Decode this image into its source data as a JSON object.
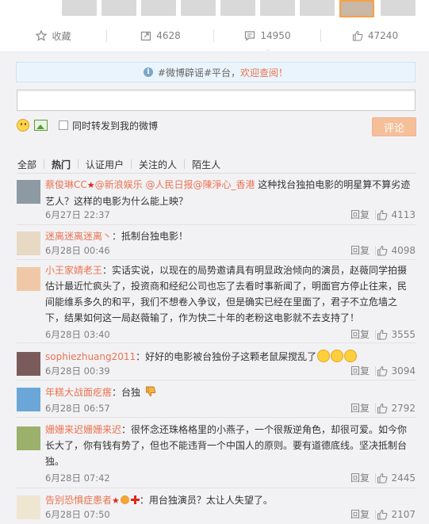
{
  "actions": {
    "favorite": "收藏",
    "repost": "4628",
    "comment": "14950",
    "like": "47240"
  },
  "notice": {
    "prefix": "#微博辟谣#平台，",
    "link": "欢迎查阅！"
  },
  "composer": {
    "input_value": "",
    "also_repost": "同时转发到我的微博",
    "submit": "评论"
  },
  "filters": [
    "全部",
    "热门",
    "认证用户",
    "关注的人",
    "陌生人"
  ],
  "comments": [
    {
      "user": "蔡俊琳CC",
      "badge": "★",
      "mentions": "@新浪娱乐 @人民日报@陳淨心_香港",
      "text": " 这种找台独拍电影的明星算不算劣迹艺人？这样的电影为什么能上映？",
      "time": "6月27日 22:37",
      "reply": "回复",
      "likes": "4113"
    },
    {
      "user": "迷离迷离迷离丶",
      "text": "：抵制台独电影！",
      "time": "6月28日 00:46",
      "reply": "回复",
      "likes": "4098"
    },
    {
      "user": "小王家婧老王",
      "text": "：实话实说，以现在的局势邀请具有明显政治倾向的演员，赵薇同学拍摄估计最近忙疯头了，投资商和经纪公司也忘了去看时事新闻了，明面官方停止往来，民间能维系多久的和平，我们不想卷入争议，但是确实已经在里面了，君子不立危墙之下，结果如何这一局赵薇输了，作为快二十年的老粉这电影就不去支持了！",
      "time": "6月28日 03:40",
      "reply": "回复",
      "likes": "3555"
    },
    {
      "user": "sophiezhuang2011",
      "text": "：好好的电影被台独份子这颗老鼠屎搅乱了",
      "time": "6月28日 00:39",
      "reply": "回复",
      "likes": "3094"
    },
    {
      "user": "年糕大战面疙瘩",
      "text": "：台独",
      "time": "6月28日 06:57",
      "reply": "回复",
      "likes": "2792"
    },
    {
      "user": "姗姗来迟姗姗来迟",
      "text": "：很怀念还珠格格里的小燕子，一个很叛逆角色，却很可爱。如今你长大了，你有钱有势了，但也不能违背一个中国人的原则。要有道德底线。坚决抵制台独。",
      "time": "6月28日 07:42",
      "reply": "回复",
      "likes": "2445"
    },
    {
      "user": "告别恐惧症患者",
      "badge": "★",
      "text": "：用台独演员？太让人失望了。",
      "time": "6月28日 07:50",
      "reply": "回复",
      "likes": "2107"
    }
  ],
  "colors": {
    "accent": "#eb7350",
    "panel_bg": "#f2f2f5",
    "notice_bg": "#eaf4fc",
    "submit_bg": "#f5bf9a"
  }
}
